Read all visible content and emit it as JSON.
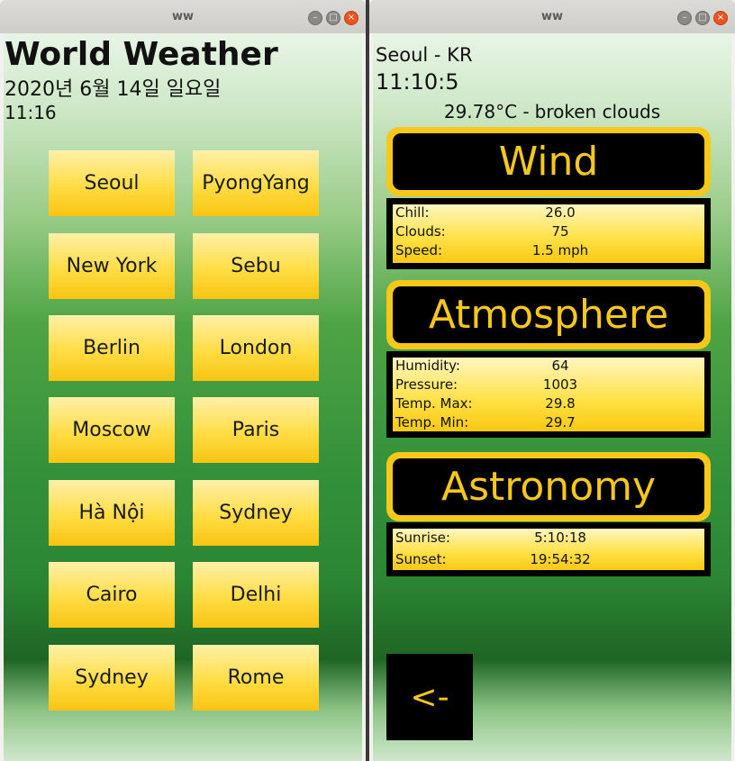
{
  "left_window": {
    "title": "ww",
    "app_title": "World Weather",
    "date": "2020년 6월 14일 일요일",
    "time": "11:16",
    "cities": [
      "Seoul",
      "PyongYang",
      "New York",
      "Sebu",
      "Berlin",
      "London",
      "Moscow",
      "Paris",
      "Hà Nội",
      "Sydney",
      "Cairo",
      "Delhi",
      "Sydney",
      "Rome"
    ]
  },
  "right_window": {
    "title": "ww",
    "location": "Seoul - KR",
    "clock": "11:10:5",
    "temperature": "29.78°C -",
    "description": "broken clouds",
    "wind": {
      "heading": "Wind",
      "rows": [
        {
          "label": "Chill:",
          "value": "26.0"
        },
        {
          "label": "Clouds:",
          "value": "75"
        },
        {
          "label": "Speed:",
          "value": "1.5 mph"
        }
      ]
    },
    "atmosphere": {
      "heading": "Atmosphere",
      "rows": [
        {
          "label": "Humidity:",
          "value": "64"
        },
        {
          "label": "Pressure:",
          "value": "1003"
        },
        {
          "label": "Temp. Max:",
          "value": "29.8"
        },
        {
          "label": "Temp. Min:",
          "value": "29.7"
        }
      ]
    },
    "astronomy": {
      "heading": "Astronomy",
      "rows": [
        {
          "label": "Sunrise:",
          "value": "5:10:18"
        },
        {
          "label": "Sunset:",
          "value": "19:54:32"
        }
      ]
    },
    "back_label": "<-"
  },
  "window_controls": {
    "minimize": "–",
    "maximize": "□",
    "close": "×"
  },
  "colors": {
    "accent": "#f7c81a",
    "panel_bg": "#000000",
    "green": "#2b8634"
  }
}
